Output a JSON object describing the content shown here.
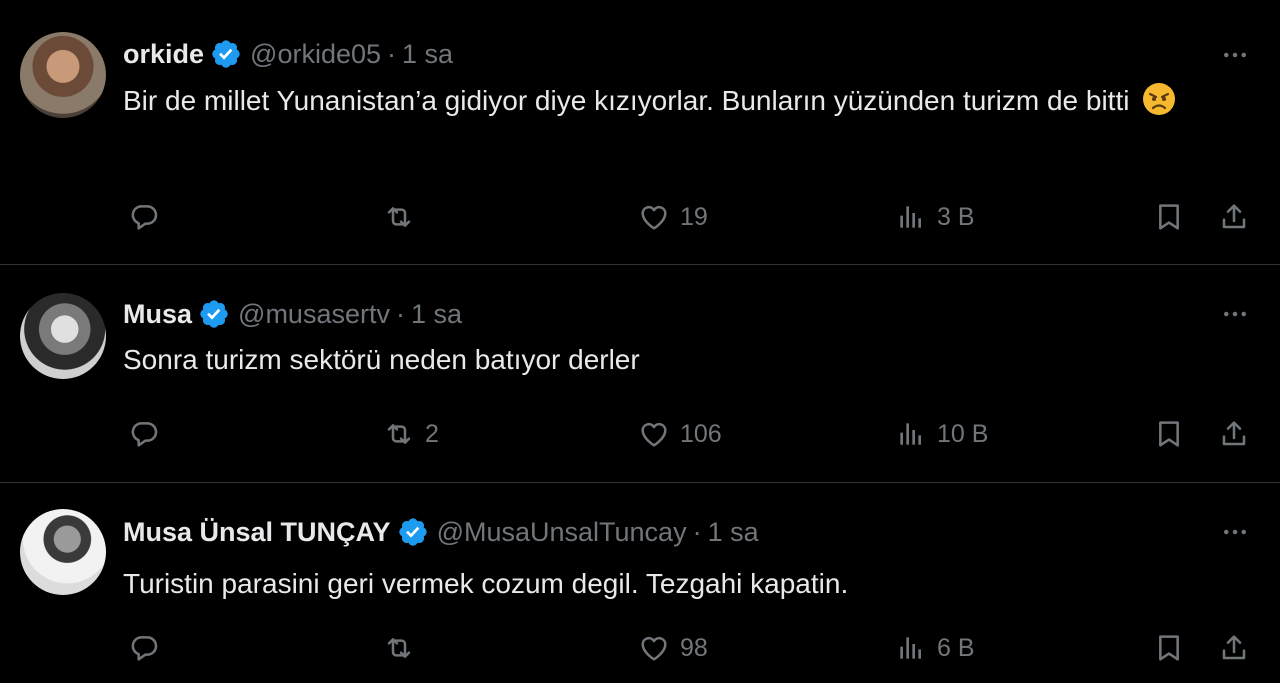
{
  "tweets": [
    {
      "name": "orkide",
      "handle": "@orkide05",
      "separator": "·",
      "time": "1 sa",
      "text": "Bir de millet Yunanistan’a gidiyor diye kızıyorlar. Bunların yüzünden turizm de bitti",
      "emoji": "angry-face-emoji",
      "replies": "",
      "retweets": "",
      "likes": "19",
      "views": "3 B"
    },
    {
      "name": "Musa",
      "handle": "@musasertv",
      "separator": "·",
      "time": "1 sa",
      "text": "Sonra turizm sektörü neden batıyor derler",
      "replies": "",
      "retweets": "2",
      "likes": "106",
      "views": "10 B"
    },
    {
      "name": "Musa Ünsal TUNÇAY",
      "handle": "@MusaUnsalTuncay",
      "separator": "·",
      "time": "1 sa",
      "text": "Turistin parasini geri vermek cozum degil. Tezgahi kapatin.",
      "replies": "",
      "retweets": "",
      "likes": "98",
      "views": "6 B"
    }
  ],
  "colors": {
    "background": "#000000",
    "text": "#e7e9ea",
    "muted": "#71767b",
    "verified": "#1d9bf0",
    "divider": "#2f3336"
  },
  "icons": [
    "verified-badge-icon",
    "more-icon",
    "reply-icon",
    "retweet-icon",
    "like-icon",
    "views-icon",
    "bookmark-icon",
    "share-icon"
  ]
}
